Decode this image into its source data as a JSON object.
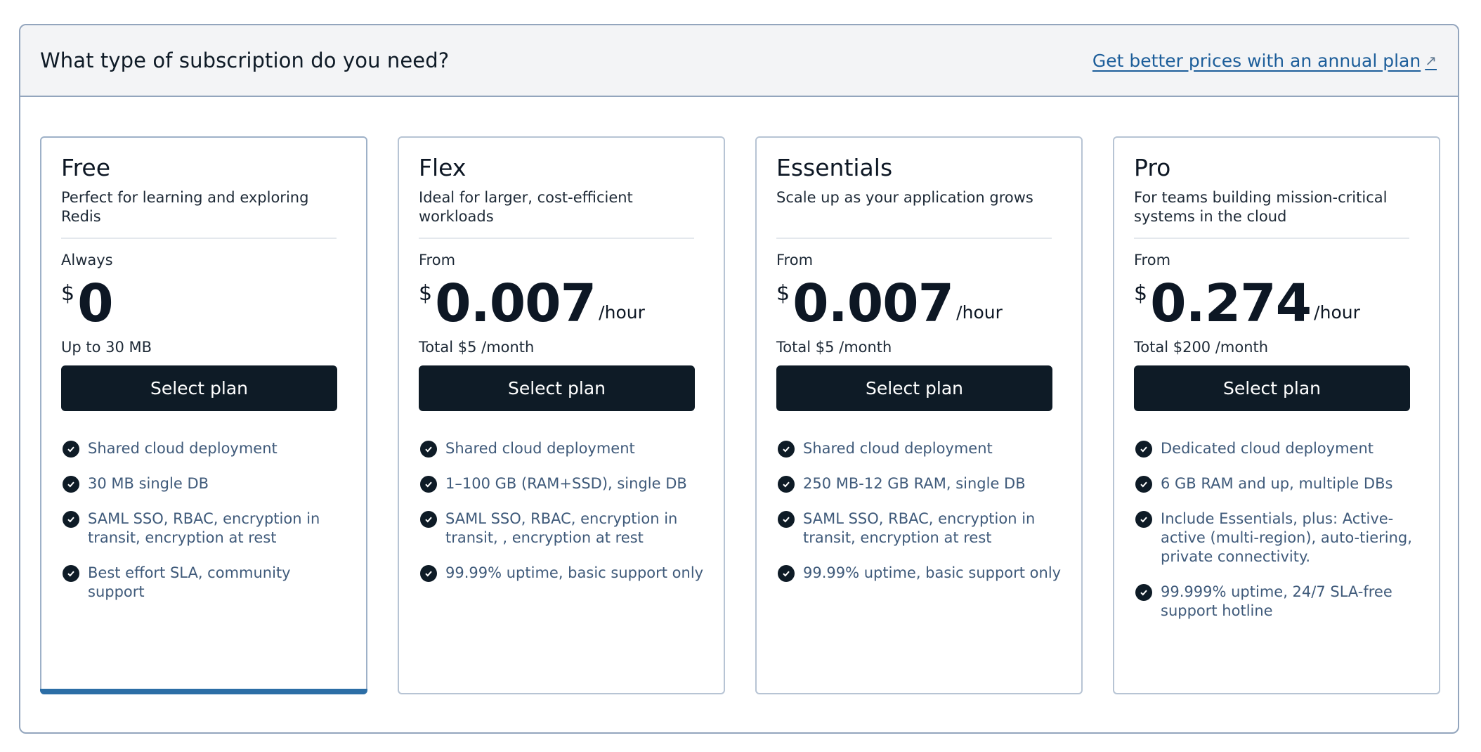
{
  "header": {
    "title": "What type of subscription do you need?",
    "annual_link": "Get better prices with an annual plan"
  },
  "colors": {
    "accent": "#2c6ea6",
    "button": "#0e1b26",
    "link": "#1d5e9a",
    "feature_text": "#3f5a7a"
  },
  "plans": [
    {
      "name": "Free",
      "description": "Perfect for learning and exploring Redis",
      "price_prefix": "Always",
      "currency": "$",
      "amount": "0",
      "unit": "",
      "note": "Up to 30 MB",
      "button_label": "Select plan",
      "selected": true,
      "features": [
        "Shared cloud deployment",
        "30 MB single DB",
        "SAML SSO, RBAC, encryption in transit, encryption at rest",
        "Best effort SLA, community support"
      ]
    },
    {
      "name": "Flex",
      "description": "Ideal for larger, cost-efficient workloads",
      "price_prefix": "From",
      "currency": "$",
      "amount": "0.007",
      "unit": "/hour",
      "note": "Total $5 /month",
      "button_label": "Select plan",
      "selected": false,
      "features": [
        "Shared cloud deployment",
        "1–100 GB (RAM+SSD), single DB",
        "SAML SSO, RBAC, encryption in transit, , encryption at rest",
        "99.99% uptime, basic support only"
      ]
    },
    {
      "name": "Essentials",
      "description": "Scale up as your application grows",
      "price_prefix": "From",
      "currency": "$",
      "amount": "0.007",
      "unit": "/hour",
      "note": "Total $5 /month",
      "button_label": "Select plan",
      "selected": false,
      "features": [
        "Shared cloud deployment",
        "250 MB-12 GB RAM, single DB",
        "SAML SSO, RBAC, encryption in transit, encryption at rest",
        "99.99% uptime, basic support only"
      ]
    },
    {
      "name": "Pro",
      "description": "For teams building mission-critical systems in the cloud",
      "price_prefix": "From",
      "currency": "$",
      "amount": "0.274",
      "unit": "/hour",
      "note": "Total $200 /month",
      "button_label": "Select plan",
      "selected": false,
      "features": [
        "Dedicated cloud deployment",
        "6 GB RAM and up, multiple DBs",
        "Include Essentials, plus: Active-active (multi-region), auto-tiering, private connectivity.",
        "99.999% uptime, 24/7 SLA-free support hotline"
      ]
    }
  ]
}
